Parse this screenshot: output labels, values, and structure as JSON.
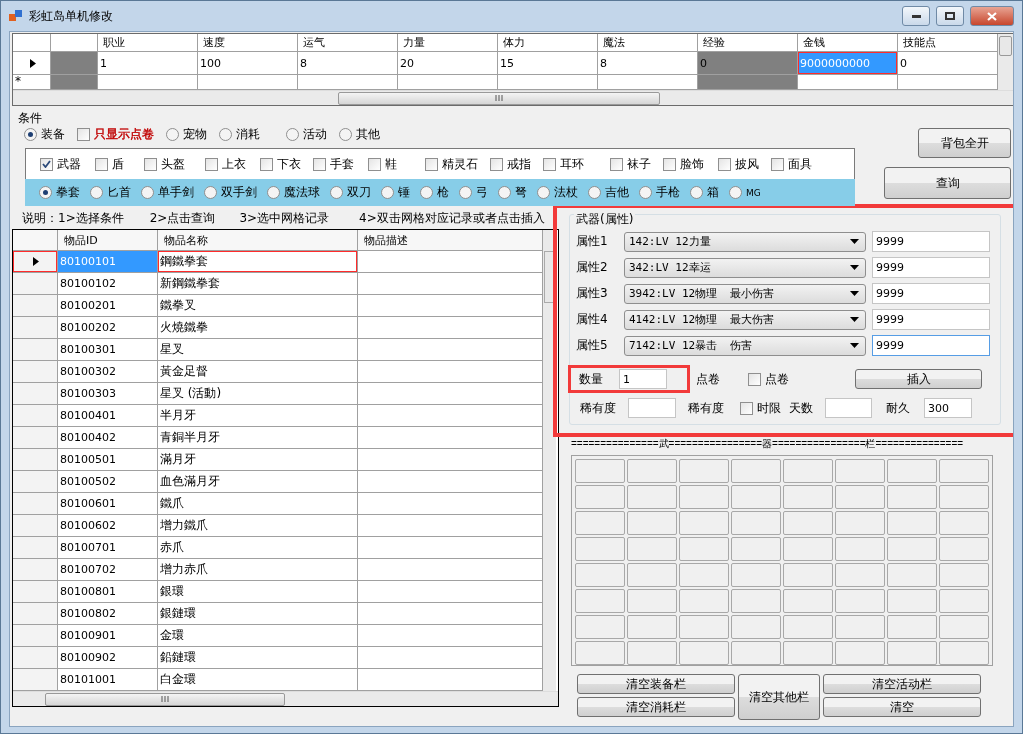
{
  "window": {
    "title": "彩虹岛单机修改"
  },
  "character_grid": {
    "columns": [
      {
        "label": "职业",
        "readonly": false
      },
      {
        "label": "速度",
        "readonly": false
      },
      {
        "label": "运气",
        "readonly": false
      },
      {
        "label": "力量",
        "readonly": false
      },
      {
        "label": "体力",
        "readonly": false
      },
      {
        "label": "魔法",
        "readonly": false
      },
      {
        "label": "经验",
        "readonly": true
      },
      {
        "label": "金钱",
        "readonly": false
      },
      {
        "label": "技能点",
        "readonly": false
      }
    ],
    "rows": [
      {
        "current": true,
        "cells": [
          {
            "value": "1",
            "selected": false,
            "highlighted": false
          },
          {
            "value": "100",
            "selected": false,
            "highlighted": false
          },
          {
            "value": "8",
            "selected": false,
            "highlighted": false
          },
          {
            "value": "20",
            "selected": false,
            "highlighted": false
          },
          {
            "value": "15",
            "selected": false,
            "highlighted": false
          },
          {
            "value": "8",
            "selected": false,
            "highlighted": false
          },
          {
            "value": "0",
            "selected": false,
            "highlighted": false
          },
          {
            "value": "9000000000",
            "selected": true,
            "highlighted": true
          },
          {
            "value": "0",
            "selected": false,
            "highlighted": false
          }
        ]
      }
    ],
    "new_row_marker": "*"
  },
  "conditions": {
    "title": "条件",
    "options": [
      {
        "kind": "radio",
        "label": "装备",
        "selected": true
      },
      {
        "kind": "checkbox",
        "label": "只显示点卷",
        "checked": false,
        "color": "#c00000"
      },
      {
        "kind": "radio",
        "label": "宠物",
        "selected": false
      },
      {
        "kind": "radio",
        "label": "消耗",
        "selected": false
      },
      {
        "kind": "radio",
        "label": "活动",
        "selected": false
      },
      {
        "kind": "radio",
        "label": "其他",
        "selected": false
      }
    ],
    "categories": [
      {
        "label": "武器",
        "checked": true
      },
      {
        "label": "盾",
        "checked": false
      },
      {
        "label": "头盔",
        "checked": false
      },
      {
        "label": "上衣",
        "checked": false
      },
      {
        "label": "下衣",
        "checked": false
      },
      {
        "label": "手套",
        "checked": false
      },
      {
        "label": "鞋",
        "checked": false
      },
      {
        "label": "精灵石",
        "checked": false
      },
      {
        "label": "戒指",
        "checked": false
      },
      {
        "label": "耳环",
        "checked": false
      },
      {
        "label": "袜子",
        "checked": false
      },
      {
        "label": "脸饰",
        "checked": false
      },
      {
        "label": "披风",
        "checked": false
      },
      {
        "label": "面具",
        "checked": false
      }
    ],
    "weapon_types": [
      {
        "label": "拳套",
        "selected": true
      },
      {
        "label": "匕首",
        "selected": false
      },
      {
        "label": "单手剑",
        "selected": false
      },
      {
        "label": "双手剑",
        "selected": false
      },
      {
        "label": "魔法球",
        "selected": false
      },
      {
        "label": "双刀",
        "selected": false
      },
      {
        "label": "锤",
        "selected": false
      },
      {
        "label": "枪",
        "selected": false
      },
      {
        "label": "弓",
        "selected": false
      },
      {
        "label": "弩",
        "selected": false
      },
      {
        "label": "法杖",
        "selected": false
      },
      {
        "label": "吉他",
        "selected": false
      },
      {
        "label": "手枪",
        "selected": false
      },
      {
        "label": "箱",
        "selected": false
      },
      {
        "label": "MG",
        "selected": false
      }
    ],
    "buttons": [
      "背包全开",
      "查询"
    ]
  },
  "instructions": [
    "说明：1>选择条件",
    "2>点击查询",
    "3>选中网格记录",
    "4>双击网格对应记录或者点击插入"
  ],
  "item_grid": {
    "columns": [
      "物品ID",
      "物品名称",
      "物品描述"
    ],
    "rows": [
      {
        "id": "80100101",
        "name": "鋼鐵拳套",
        "selected": true,
        "highlighted": true
      },
      {
        "id": "80100102",
        "name": "新鋼鐵拳套",
        "selected": false,
        "highlighted": false
      },
      {
        "id": "80100201",
        "name": "鐵拳叉",
        "selected": false,
        "highlighted": false
      },
      {
        "id": "80100202",
        "name": "火燒鐵拳",
        "selected": false,
        "highlighted": false
      },
      {
        "id": "80100301",
        "name": "星叉",
        "selected": false,
        "highlighted": false
      },
      {
        "id": "80100302",
        "name": "黃金足督",
        "selected": false,
        "highlighted": false
      },
      {
        "id": "80100303",
        "name": "星叉 (活動)",
        "selected": false,
        "highlighted": false
      },
      {
        "id": "80100401",
        "name": "半月牙",
        "selected": false,
        "highlighted": false
      },
      {
        "id": "80100402",
        "name": "青銅半月牙",
        "selected": false,
        "highlighted": false
      },
      {
        "id": "80100501",
        "name": "滿月牙",
        "selected": false,
        "highlighted": false
      },
      {
        "id": "80100502",
        "name": "血色滿月牙",
        "selected": false,
        "highlighted": false
      },
      {
        "id": "80100601",
        "name": "鐵爪",
        "selected": false,
        "highlighted": false
      },
      {
        "id": "80100602",
        "name": "增力鐵爪",
        "selected": false,
        "highlighted": false
      },
      {
        "id": "80100701",
        "name": "赤爪",
        "selected": false,
        "highlighted": false
      },
      {
        "id": "80100702",
        "name": "增力赤爪",
        "selected": false,
        "highlighted": false
      },
      {
        "id": "80100801",
        "name": "銀環",
        "selected": false,
        "highlighted": false
      },
      {
        "id": "80100802",
        "name": "銀鏈環",
        "selected": false,
        "highlighted": false
      },
      {
        "id": "80100901",
        "name": "金環",
        "selected": false,
        "highlighted": false
      },
      {
        "id": "80100902",
        "name": "鉛鏈環",
        "selected": false,
        "highlighted": false
      },
      {
        "id": "80101001",
        "name": "白金環",
        "selected": false,
        "highlighted": false
      }
    ]
  },
  "attribute_panel": {
    "title": "武器(属性)",
    "highlighted": true,
    "attributes": [
      {
        "label": "属性1",
        "option": "142:LV 12力量",
        "value": "9999",
        "focused": false
      },
      {
        "label": "属性2",
        "option": "342:LV 12幸运",
        "value": "9999",
        "focused": false
      },
      {
        "label": "属性3",
        "option": "3942:LV 12物理  最小伤害",
        "value": "9999",
        "focused": false
      },
      {
        "label": "属性4",
        "option": "4142:LV 12物理  最大伤害",
        "value": "9999",
        "focused": false
      },
      {
        "label": "属性5",
        "option": "7142:LV 12暴击  伤害",
        "value": "9999",
        "focused": true
      }
    ],
    "quantity": {
      "label": "数量",
      "value": "1",
      "highlighted": true
    },
    "coupon_label": "点卷",
    "coupon_checkbox": {
      "label": "点卷",
      "checked": false
    },
    "insert_button": "插入",
    "rarity_label": "稀有度",
    "rarity_label_2": "稀有度",
    "time_limit": {
      "label": "时限",
      "checked": false
    },
    "days_label": "天数",
    "durability": {
      "label": "耐久",
      "value": "300"
    }
  },
  "inventory": {
    "title": "===============武================器================栏==============="
  },
  "clear_buttons": [
    {
      "label": "清空装备栏",
      "kind": "small"
    },
    {
      "label": "清空消耗栏",
      "kind": "small"
    },
    {
      "label": "清空其他栏",
      "kind": "tall"
    },
    {
      "label": "清空活动栏",
      "kind": "small"
    },
    {
      "label": "清空",
      "kind": "small"
    }
  ]
}
